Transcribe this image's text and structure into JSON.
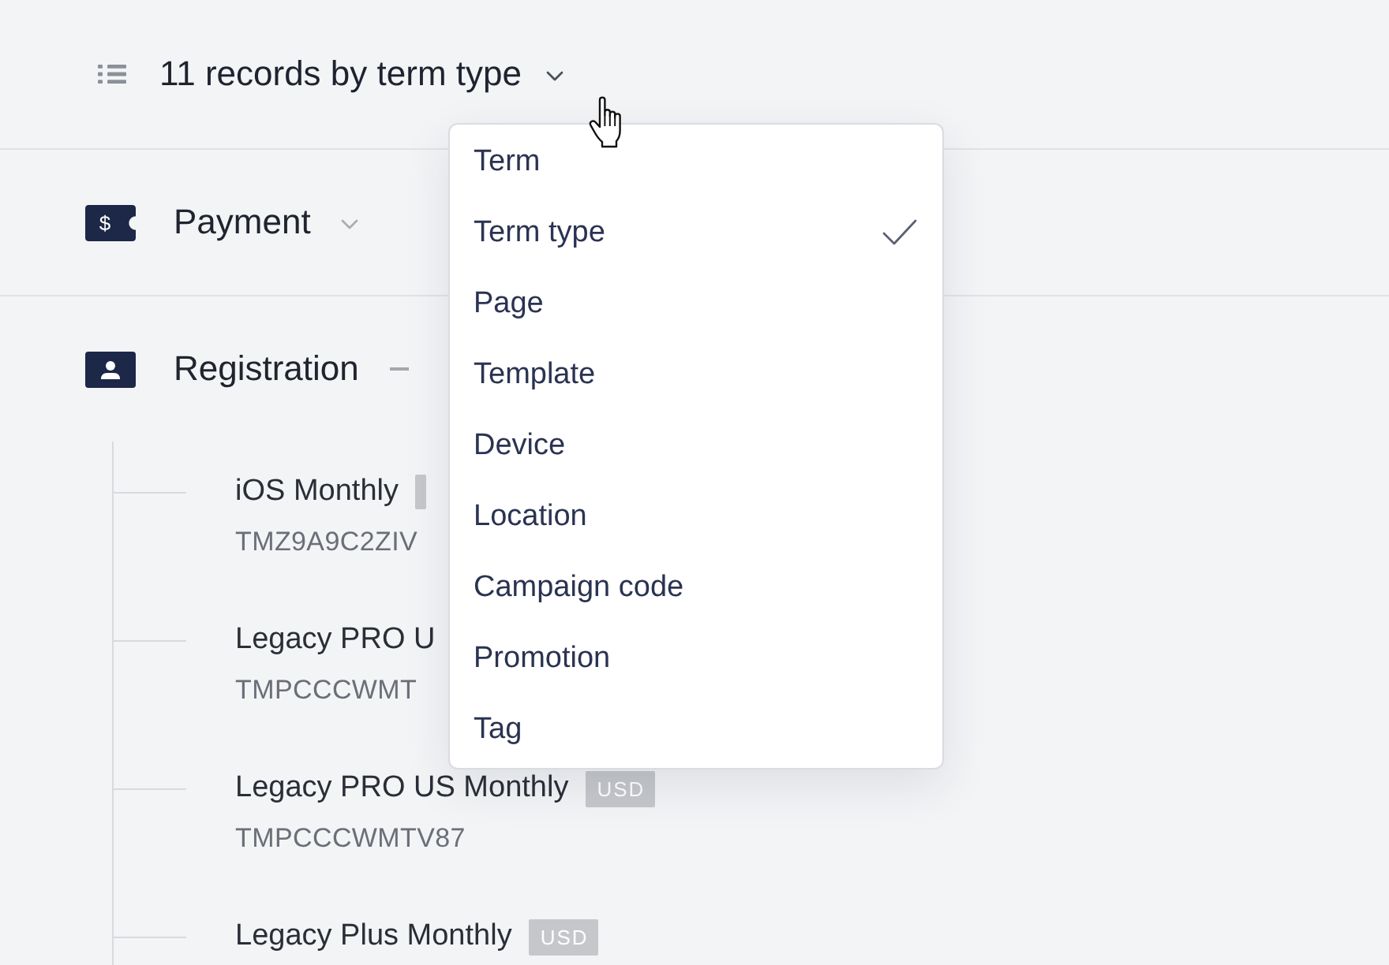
{
  "header": {
    "title": "11 records by term type"
  },
  "groups": [
    {
      "label": "Payment",
      "kind": "ticket",
      "glyph": "$",
      "expanded": false
    },
    {
      "label": "Registration",
      "kind": "person",
      "expanded": true,
      "items": [
        {
          "title": "iOS Monthly",
          "code": "TMZ9A9C2ZIV",
          "badge": {
            "kind": "covered"
          }
        },
        {
          "title": "Legacy PRO U",
          "code": "TMPCCCWMT"
        },
        {
          "title": "Legacy PRO US Monthly",
          "code": "TMPCCCWMTV87",
          "badge": {
            "kind": "label",
            "text": "USD"
          }
        },
        {
          "title": "Legacy Plus Monthly",
          "badge": {
            "kind": "label",
            "text": "USD"
          }
        }
      ]
    }
  ],
  "dropdown": {
    "options": [
      {
        "label": "Term",
        "selected": false
      },
      {
        "label": "Term type",
        "selected": true
      },
      {
        "label": "Page",
        "selected": false
      },
      {
        "label": "Template",
        "selected": false
      },
      {
        "label": "Device",
        "selected": false
      },
      {
        "label": "Location",
        "selected": false
      },
      {
        "label": "Campaign code",
        "selected": false
      },
      {
        "label": "Promotion",
        "selected": false
      },
      {
        "label": "Tag",
        "selected": false
      }
    ]
  }
}
